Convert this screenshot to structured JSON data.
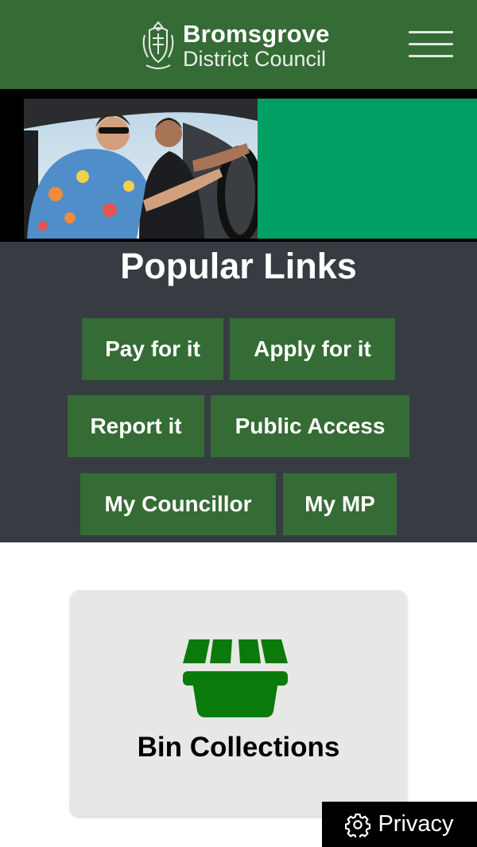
{
  "header": {
    "logo_line1": "Bromsgrove",
    "logo_line2": "District Council",
    "menu_icon": "hamburger-menu-icon"
  },
  "colors": {
    "brand_green": "#356b35",
    "hero_green": "#00a064",
    "popular_bg": "#373c43",
    "bin_icon": "#0a7a0a"
  },
  "popular": {
    "title": "Popular Links",
    "links": [
      {
        "label": "Pay for it"
      },
      {
        "label": "Apply for it"
      },
      {
        "label": "Report it"
      },
      {
        "label": "Public Access"
      },
      {
        "label": "My Councillor"
      },
      {
        "label": "My MP"
      }
    ]
  },
  "bin_card": {
    "icon": "bin-icon",
    "label": "Bin Collections"
  },
  "privacy": {
    "icon": "gear-icon",
    "label": "Privacy"
  }
}
